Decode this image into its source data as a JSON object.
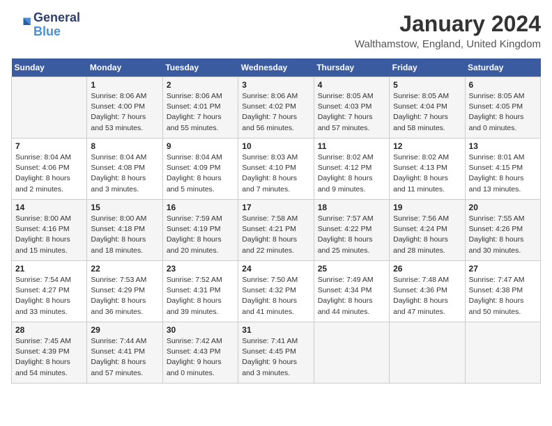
{
  "header": {
    "logo_line1": "General",
    "logo_line2": "Blue",
    "month_title": "January 2024",
    "location": "Walthamstow, England, United Kingdom"
  },
  "days_of_week": [
    "Sunday",
    "Monday",
    "Tuesday",
    "Wednesday",
    "Thursday",
    "Friday",
    "Saturday"
  ],
  "weeks": [
    [
      {
        "day": "",
        "info": ""
      },
      {
        "day": "1",
        "info": "Sunrise: 8:06 AM\nSunset: 4:00 PM\nDaylight: 7 hours\nand 53 minutes."
      },
      {
        "day": "2",
        "info": "Sunrise: 8:06 AM\nSunset: 4:01 PM\nDaylight: 7 hours\nand 55 minutes."
      },
      {
        "day": "3",
        "info": "Sunrise: 8:06 AM\nSunset: 4:02 PM\nDaylight: 7 hours\nand 56 minutes."
      },
      {
        "day": "4",
        "info": "Sunrise: 8:05 AM\nSunset: 4:03 PM\nDaylight: 7 hours\nand 57 minutes."
      },
      {
        "day": "5",
        "info": "Sunrise: 8:05 AM\nSunset: 4:04 PM\nDaylight: 7 hours\nand 58 minutes."
      },
      {
        "day": "6",
        "info": "Sunrise: 8:05 AM\nSunset: 4:05 PM\nDaylight: 8 hours\nand 0 minutes."
      }
    ],
    [
      {
        "day": "7",
        "info": "Sunrise: 8:04 AM\nSunset: 4:06 PM\nDaylight: 8 hours\nand 2 minutes."
      },
      {
        "day": "8",
        "info": "Sunrise: 8:04 AM\nSunset: 4:08 PM\nDaylight: 8 hours\nand 3 minutes."
      },
      {
        "day": "9",
        "info": "Sunrise: 8:04 AM\nSunset: 4:09 PM\nDaylight: 8 hours\nand 5 minutes."
      },
      {
        "day": "10",
        "info": "Sunrise: 8:03 AM\nSunset: 4:10 PM\nDaylight: 8 hours\nand 7 minutes."
      },
      {
        "day": "11",
        "info": "Sunrise: 8:02 AM\nSunset: 4:12 PM\nDaylight: 8 hours\nand 9 minutes."
      },
      {
        "day": "12",
        "info": "Sunrise: 8:02 AM\nSunset: 4:13 PM\nDaylight: 8 hours\nand 11 minutes."
      },
      {
        "day": "13",
        "info": "Sunrise: 8:01 AM\nSunset: 4:15 PM\nDaylight: 8 hours\nand 13 minutes."
      }
    ],
    [
      {
        "day": "14",
        "info": "Sunrise: 8:00 AM\nSunset: 4:16 PM\nDaylight: 8 hours\nand 15 minutes."
      },
      {
        "day": "15",
        "info": "Sunrise: 8:00 AM\nSunset: 4:18 PM\nDaylight: 8 hours\nand 18 minutes."
      },
      {
        "day": "16",
        "info": "Sunrise: 7:59 AM\nSunset: 4:19 PM\nDaylight: 8 hours\nand 20 minutes."
      },
      {
        "day": "17",
        "info": "Sunrise: 7:58 AM\nSunset: 4:21 PM\nDaylight: 8 hours\nand 22 minutes."
      },
      {
        "day": "18",
        "info": "Sunrise: 7:57 AM\nSunset: 4:22 PM\nDaylight: 8 hours\nand 25 minutes."
      },
      {
        "day": "19",
        "info": "Sunrise: 7:56 AM\nSunset: 4:24 PM\nDaylight: 8 hours\nand 28 minutes."
      },
      {
        "day": "20",
        "info": "Sunrise: 7:55 AM\nSunset: 4:26 PM\nDaylight: 8 hours\nand 30 minutes."
      }
    ],
    [
      {
        "day": "21",
        "info": "Sunrise: 7:54 AM\nSunset: 4:27 PM\nDaylight: 8 hours\nand 33 minutes."
      },
      {
        "day": "22",
        "info": "Sunrise: 7:53 AM\nSunset: 4:29 PM\nDaylight: 8 hours\nand 36 minutes."
      },
      {
        "day": "23",
        "info": "Sunrise: 7:52 AM\nSunset: 4:31 PM\nDaylight: 8 hours\nand 39 minutes."
      },
      {
        "day": "24",
        "info": "Sunrise: 7:50 AM\nSunset: 4:32 PM\nDaylight: 8 hours\nand 41 minutes."
      },
      {
        "day": "25",
        "info": "Sunrise: 7:49 AM\nSunset: 4:34 PM\nDaylight: 8 hours\nand 44 minutes."
      },
      {
        "day": "26",
        "info": "Sunrise: 7:48 AM\nSunset: 4:36 PM\nDaylight: 8 hours\nand 47 minutes."
      },
      {
        "day": "27",
        "info": "Sunrise: 7:47 AM\nSunset: 4:38 PM\nDaylight: 8 hours\nand 50 minutes."
      }
    ],
    [
      {
        "day": "28",
        "info": "Sunrise: 7:45 AM\nSunset: 4:39 PM\nDaylight: 8 hours\nand 54 minutes."
      },
      {
        "day": "29",
        "info": "Sunrise: 7:44 AM\nSunset: 4:41 PM\nDaylight: 8 hours\nand 57 minutes."
      },
      {
        "day": "30",
        "info": "Sunrise: 7:42 AM\nSunset: 4:43 PM\nDaylight: 9 hours\nand 0 minutes."
      },
      {
        "day": "31",
        "info": "Sunrise: 7:41 AM\nSunset: 4:45 PM\nDaylight: 9 hours\nand 3 minutes."
      },
      {
        "day": "",
        "info": ""
      },
      {
        "day": "",
        "info": ""
      },
      {
        "day": "",
        "info": ""
      }
    ]
  ]
}
